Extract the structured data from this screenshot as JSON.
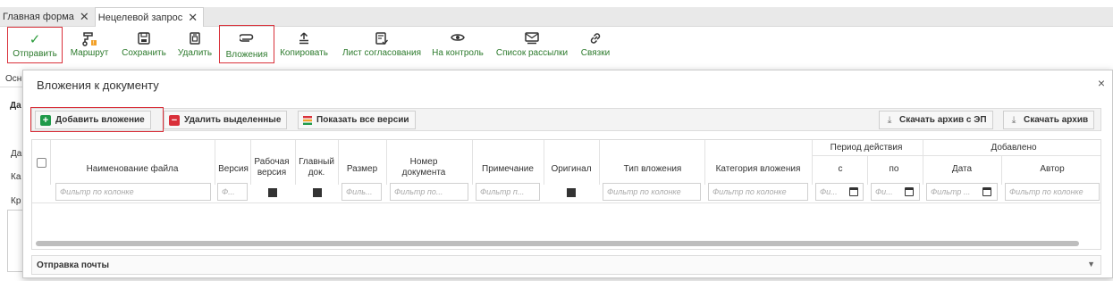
{
  "tabs": [
    {
      "label": "Главная форма",
      "close": "✕"
    },
    {
      "label": "Нецелевой запрос",
      "close": "✕"
    }
  ],
  "toolbar": {
    "send": "Отправить",
    "route": "Маршрут",
    "save": "Сохранить",
    "delete": "Удалить",
    "attachments": "Вложения",
    "copy": "Копировать",
    "approval_sheet": "Лист согласования",
    "on_control": "На контроль",
    "mailing_list": "Список рассылки",
    "links": "Связки"
  },
  "background": {
    "label_osn": "Осн",
    "label_da": "Да",
    "label_da2": "Да",
    "label_ka": "Ка",
    "label_kr": "Кр"
  },
  "dialog": {
    "title": "Вложения к документу",
    "close": "×",
    "buttons": {
      "add": "Добавить вложение",
      "delete_selected": "Удалить выделенные",
      "show_versions": "Показать все версии",
      "download_archive_ep": "Скачать архив с ЭП",
      "download_archive": "Скачать архив"
    },
    "columns": {
      "file_name": "Наименование файла",
      "version": "Версия",
      "working_version_1": "Рабочая",
      "working_version_2": "версия",
      "main_doc_1": "Главный",
      "main_doc_2": "док.",
      "size": "Размер",
      "doc_number_1": "Номер",
      "doc_number_2": "документа",
      "note": "Примечание",
      "original": "Оригинал",
      "attachment_type": "Тип вложения",
      "attachment_category": "Категория вложения",
      "validity_period": "Период действия",
      "from": "с",
      "to": "по",
      "added": "Добавлено",
      "date": "Дата",
      "author": "Автор"
    },
    "filters": {
      "file_name": "Фильтр по колонке",
      "version": "Ф...",
      "size": "Филь...",
      "doc_number": "Фильтр по...",
      "note": "Фильтр п...",
      "attachment_type": "Фильтр по колонке",
      "attachment_category": "Фильтр по колонке",
      "from": "Фи...",
      "to": "Фи...",
      "date": "Фильтр ...",
      "author": "Фильтр по колонке"
    },
    "mail_panel": "Отправка почты",
    "mail_panel_chevron": "▼"
  },
  "colors": {
    "accent_green": "#2b9b3a",
    "highlight_red": "#d9303a",
    "delete_red": "#d9303a"
  }
}
